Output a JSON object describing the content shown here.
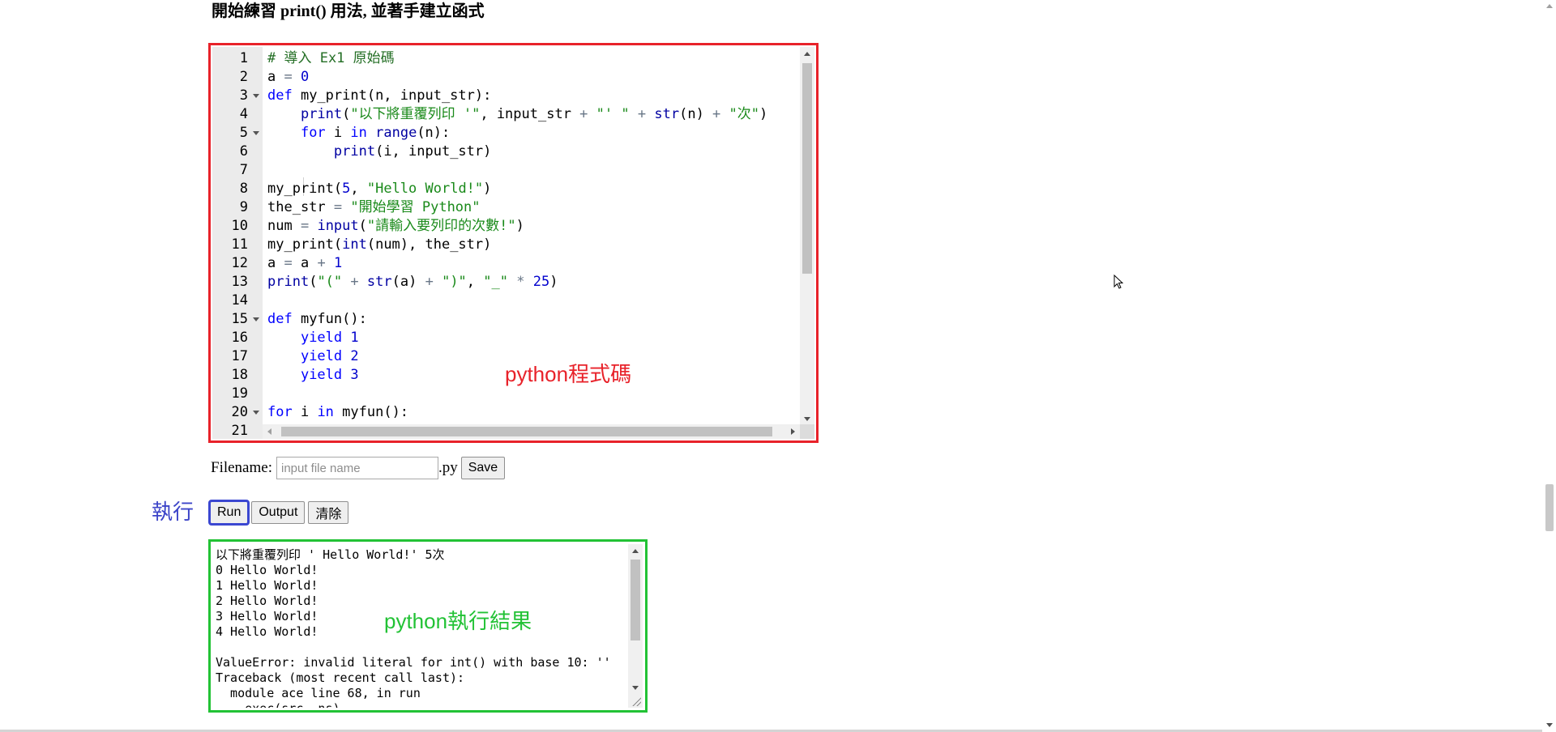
{
  "page": {
    "heading": "開始練習 print() 用法, 並著手建立函式"
  },
  "editor": {
    "annotation": "python程式碼",
    "lines": [
      {
        "n": "1",
        "fold": false,
        "html": "<span class=\"cm\"># 導入 Ex1 原始碼</span>"
      },
      {
        "n": "2",
        "fold": false,
        "html": "a <span class=\"op\">=</span> <span class=\"num\">0</span>"
      },
      {
        "n": "3",
        "fold": true,
        "html": "<span class=\"kw\">def</span> my_print(n, input_str):"
      },
      {
        "n": "4",
        "fold": false,
        "html": "    <span class=\"fn\">print</span>(<span class=\"str\">\"以下將重覆列印 '\"</span>, input_str <span class=\"op\">+</span> <span class=\"str\">\"' \"</span> <span class=\"op\">+</span> <span class=\"fn\">str</span>(n) <span class=\"op\">+</span> <span class=\"str\">\"次\"</span>)"
      },
      {
        "n": "5",
        "fold": true,
        "html": "    <span class=\"kw\">for</span> i <span class=\"kw\">in</span> <span class=\"fn\">range</span>(n):"
      },
      {
        "n": "6",
        "fold": false,
        "html": "        <span class=\"fn\">print</span>(i, input_str)"
      },
      {
        "n": "7",
        "fold": false,
        "html": ""
      },
      {
        "n": "8",
        "fold": false,
        "html": "my_print(<span class=\"num\">5</span>, <span class=\"str\">\"Hello World!\"</span>)"
      },
      {
        "n": "9",
        "fold": false,
        "html": "the_str <span class=\"op\">=</span> <span class=\"str\">\"開始學習 Python\"</span>"
      },
      {
        "n": "10",
        "fold": false,
        "html": "num <span class=\"op\">=</span> <span class=\"fn\">input</span>(<span class=\"str\">\"請輸入要列印的次數!\"</span>)"
      },
      {
        "n": "11",
        "fold": false,
        "html": "my_print(<span class=\"fn\">int</span>(num), the_str)"
      },
      {
        "n": "12",
        "fold": false,
        "html": "a <span class=\"op\">=</span> a <span class=\"op\">+</span> <span class=\"num\">1</span>"
      },
      {
        "n": "13",
        "fold": false,
        "html": "<span class=\"fn\">print</span>(<span class=\"str\">\"(\"</span> <span class=\"op\">+</span> <span class=\"fn\">str</span>(a) <span class=\"op\">+</span> <span class=\"str\">\")\"</span>, <span class=\"str\">\"_\"</span> <span class=\"op\">*</span> <span class=\"num\">25</span>)"
      },
      {
        "n": "14",
        "fold": false,
        "html": ""
      },
      {
        "n": "15",
        "fold": true,
        "html": "<span class=\"kw\">def</span> myfun():"
      },
      {
        "n": "16",
        "fold": false,
        "html": "    <span class=\"kw\">yield</span> <span class=\"num\">1</span>"
      },
      {
        "n": "17",
        "fold": false,
        "html": "    <span class=\"kw\">yield</span> <span class=\"num\">2</span>"
      },
      {
        "n": "18",
        "fold": false,
        "html": "    <span class=\"kw\">yield</span> <span class=\"num\">3</span>"
      },
      {
        "n": "19",
        "fold": false,
        "html": ""
      },
      {
        "n": "20",
        "fold": true,
        "html": "<span class=\"kw\">for</span> i <span class=\"kw\">in</span> myfun():"
      },
      {
        "n": "21",
        "fold": false,
        "html": ""
      }
    ]
  },
  "file_row": {
    "label": "Filename:",
    "placeholder": "input file name",
    "extension": ".py",
    "save_label": "Save"
  },
  "run_row": {
    "exec_label": "執行",
    "run_label": "Run",
    "output_label": "Output",
    "clear_label": "清除"
  },
  "output": {
    "annotation": "python執行結果",
    "lines": [
      "以下將重覆列印 ' Hello World!' 5次",
      "0 Hello World!",
      "1 Hello World!",
      "2 Hello World!",
      "3 Hello World!",
      "4 Hello World!",
      "",
      "ValueError: invalid literal for int() with base 10: ''",
      "Traceback (most recent call last):",
      "  module ace line 68, in run",
      "    exec(src, ns)"
    ]
  }
}
